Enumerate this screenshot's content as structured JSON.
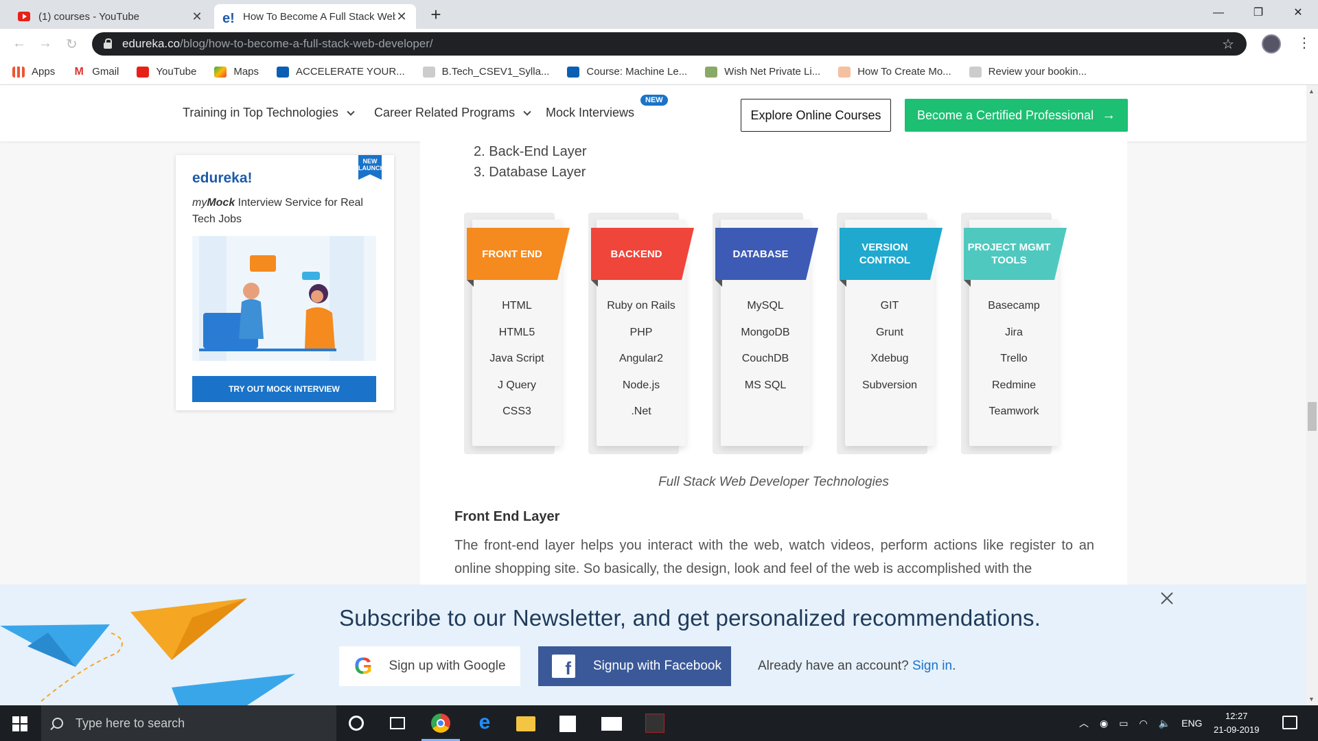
{
  "browser": {
    "tabs": [
      {
        "title": "(1) courses - YouTube",
        "active": false
      },
      {
        "title": "How To Become A Full Stack Web",
        "active": true
      }
    ],
    "url_domain": "edureka.co",
    "url_path": "/blog/how-to-become-a-full-stack-web-developer/",
    "bookmarks": [
      {
        "label": "Apps",
        "icon": "apps-grid-icon"
      },
      {
        "label": "Gmail",
        "icon": "gmail-icon"
      },
      {
        "label": "YouTube",
        "icon": "youtube-icon"
      },
      {
        "label": "Maps",
        "icon": "maps-icon"
      },
      {
        "label": "ACCELERATE YOUR...",
        "icon": "intel-icon"
      },
      {
        "label": "B.Tech_CSEV1_Sylla...",
        "icon": "globe-icon"
      },
      {
        "label": "Course: Machine Le...",
        "icon": "intel-icon"
      },
      {
        "label": "Wish Net Private Li...",
        "icon": "image-icon"
      },
      {
        "label": "How To Create Mo...",
        "icon": "doc-icon"
      },
      {
        "label": "Review your bookin...",
        "icon": "globe-icon"
      }
    ]
  },
  "header": {
    "nav": [
      {
        "label": "Training in Top Technologies",
        "dropdown": true
      },
      {
        "label": "Career Related Programs",
        "dropdown": true
      },
      {
        "label": "Mock Interviews",
        "dropdown": false
      }
    ],
    "new_badge": "NEW",
    "explore_label": "Explore Online Courses",
    "certified_label": "Become a Certified Professional",
    "accent": "#1dbf73"
  },
  "article": {
    "list_items": [
      "2. Back-End Layer",
      "3. Database Layer"
    ],
    "tech_columns": [
      {
        "title": "FRONT END",
        "color": "#f58a1f",
        "items": [
          "HTML",
          "HTML5",
          "Java Script",
          "J Query",
          "CSS3"
        ]
      },
      {
        "title": "BACKEND",
        "color": "#f0453a",
        "items": [
          "Ruby on Rails",
          "PHP",
          "Angular2",
          "Node.js",
          ".Net"
        ]
      },
      {
        "title": "DATABASE",
        "color": "#3d5bb5",
        "items": [
          "MySQL",
          "MongoDB",
          "CouchDB",
          "MS SQL"
        ]
      },
      {
        "title": "VERSION CONTROL",
        "color": "#1fa9cf",
        "items": [
          "GIT",
          "Grunt",
          "Xdebug",
          "Subversion"
        ]
      },
      {
        "title": "PROJECT MGMT TOOLS",
        "color": "#4fc9bf",
        "items": [
          "Basecamp",
          "Jira",
          "Trello",
          "Redmine",
          "Teamwork"
        ]
      }
    ],
    "caption": "Full Stack Web Developer Technologies",
    "heading": "Front End Layer",
    "paragraph": "The front-end layer helps you interact with the web, watch videos, perform actions like register to an online shopping site. So basically, the design, look and feel of the web is accomplished with the"
  },
  "sidebar_ad": {
    "brand": "edureka!",
    "ribbon": "NEW LAUNCH",
    "tagline_prefix": "my",
    "tagline_bold": "Mock",
    "tagline_rest": " Interview Service for Real Tech Jobs",
    "cta": "TRY OUT MOCK INTERVIEW"
  },
  "newsletter": {
    "title": "Subscribe to our Newsletter, and get personalized recommendations.",
    "google_label": "Sign up with Google",
    "facebook_label": "Signup with Facebook",
    "already_text": "Already have an account?",
    "signin_link": "Sign in",
    "signin_suffix": "."
  },
  "taskbar": {
    "search_placeholder": "Type here to search",
    "language": "ENG",
    "time": "12:27",
    "date": "21-09-2019"
  }
}
